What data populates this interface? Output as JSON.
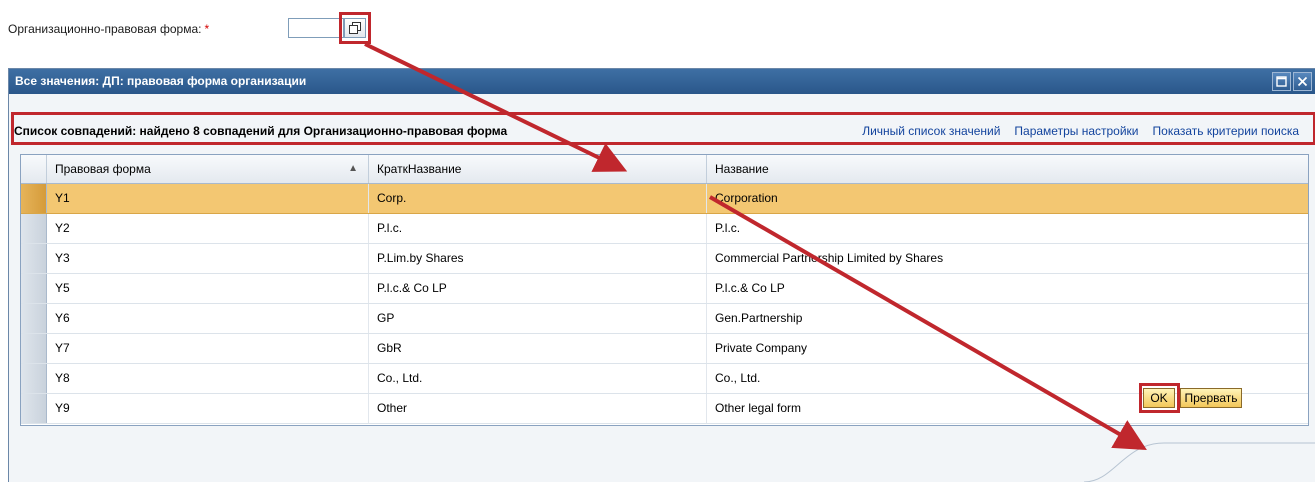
{
  "field": {
    "label": "Организационно-правовая форма:",
    "required_marker": "*",
    "value": ""
  },
  "dialog": {
    "title": "Все значения: ДП: правовая форма организации",
    "results_title": "Список совпадений: найдено 8 совпадений для Организационно-правовая форма",
    "links": [
      "Личный список значений",
      "Параметры настройки",
      "Показать критерии поиска"
    ],
    "columns": [
      "Правовая форма",
      "КраткНазвание",
      "Название"
    ],
    "rows": [
      {
        "code": "Y1",
        "short": "Corp.",
        "name": "Corporation"
      },
      {
        "code": "Y2",
        "short": "P.l.c.",
        "name": "P.l.c."
      },
      {
        "code": "Y3",
        "short": "P.Lim.by Shares",
        "name": "Commercial Partnership Limited by Shares"
      },
      {
        "code": "Y5",
        "short": "P.l.c.& Co LP",
        "name": "P.l.c.& Co LP"
      },
      {
        "code": "Y6",
        "short": "GP",
        "name": "Gen.Partnership"
      },
      {
        "code": "Y7",
        "short": "GbR",
        "name": "Private Company"
      },
      {
        "code": "Y8",
        "short": "Co., Ltd.",
        "name": "Co., Ltd."
      },
      {
        "code": "Y9",
        "short": "Other",
        "name": "Other legal form"
      }
    ],
    "selected_row": 0,
    "buttons": {
      "ok": "OK",
      "cancel": "Прервать"
    }
  },
  "colors": {
    "titlebar": "#2f5d92",
    "selected_row": "#f3c772",
    "highlight": "#c0272d",
    "link": "#12439d"
  },
  "icons": [
    "value-help-icon",
    "maximize-icon",
    "close-icon",
    "sort-ascending-icon"
  ]
}
